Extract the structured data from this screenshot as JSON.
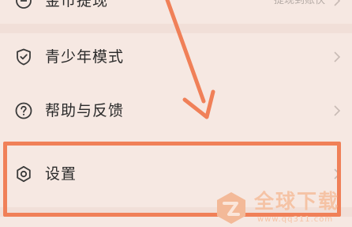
{
  "menu": {
    "items": [
      {
        "label": "金币提现",
        "value": "提现到账快",
        "icon": "coin-icon"
      },
      {
        "label": "青少年模式",
        "icon": "shield-icon"
      },
      {
        "label": "帮助与反馈",
        "icon": "help-icon"
      },
      {
        "label": "设置",
        "icon": "gear-icon"
      }
    ]
  },
  "annotation": {
    "highlight_color": "#f08058",
    "arrow_color": "#f08058"
  },
  "watermark": {
    "title": "全球下载",
    "url": "www.qq311.com"
  },
  "colors": {
    "background": "#f6e8e2",
    "text": "#2a2a2a",
    "muted": "#b5aba6"
  }
}
